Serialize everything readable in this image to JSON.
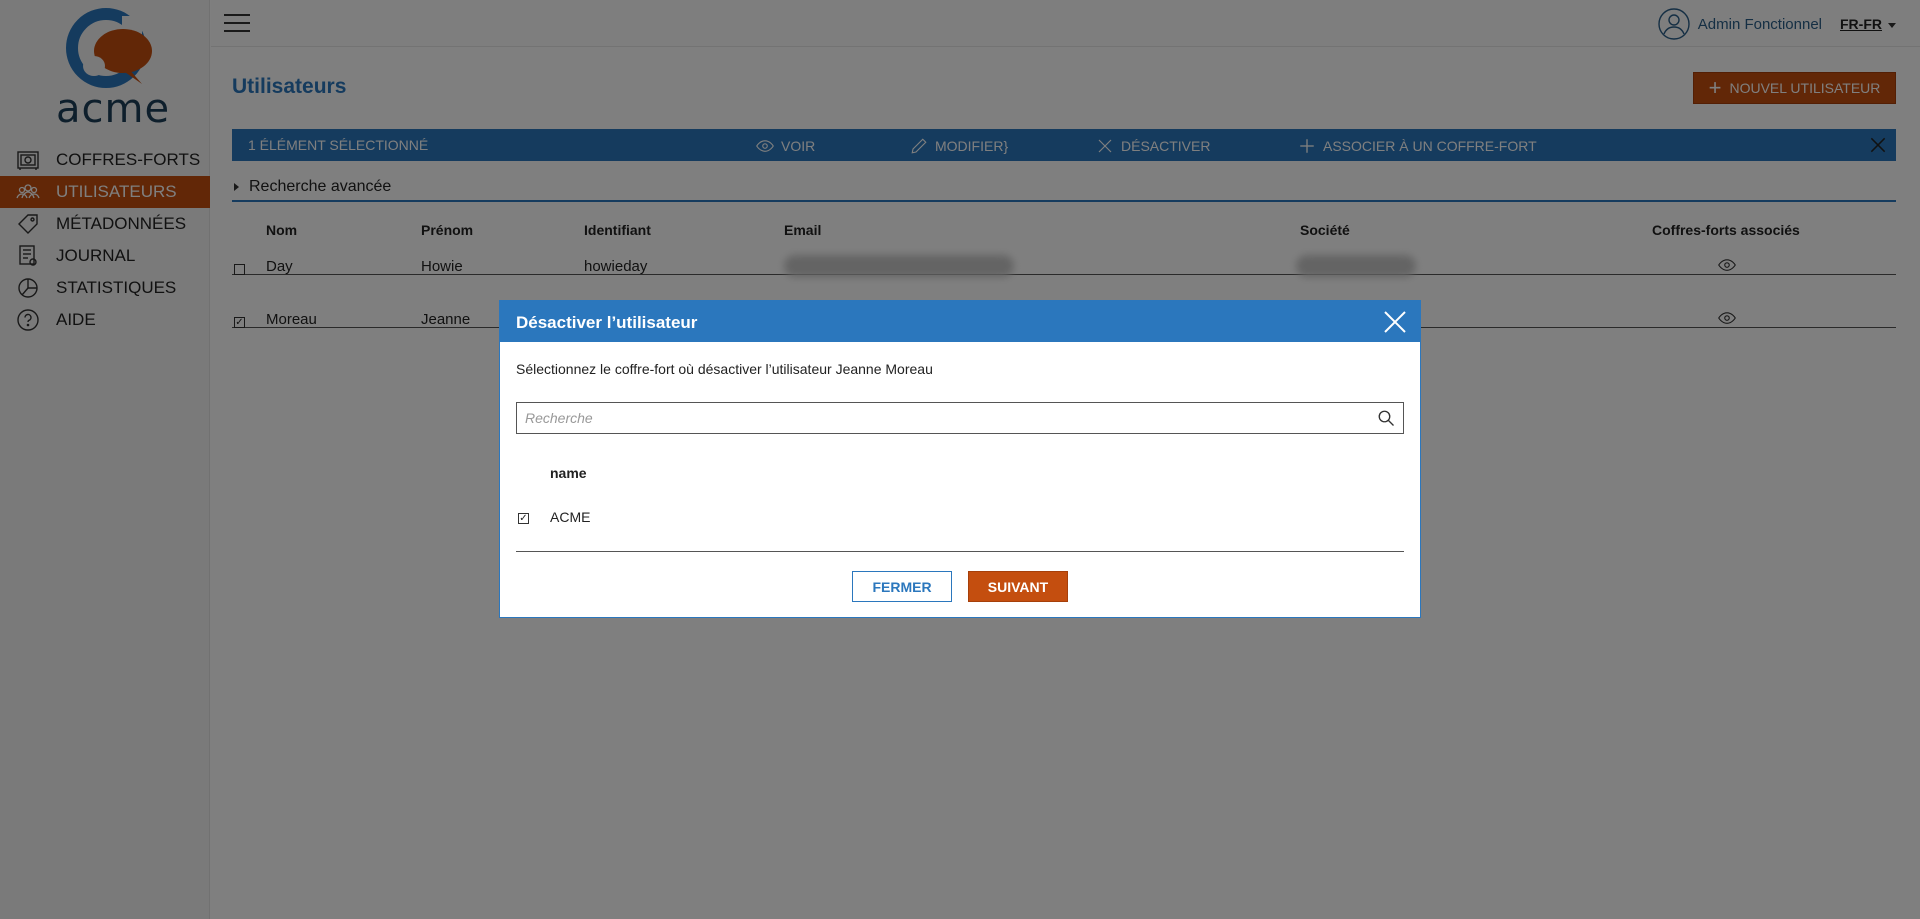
{
  "brand": {
    "name": "acme",
    "primary_color": "#2b77bd",
    "accent_color": "#c44e0f"
  },
  "sidebar": {
    "items": [
      {
        "label": "COFFRES-FORTS",
        "icon": "safe-icon"
      },
      {
        "label": "UTILISATEURS",
        "icon": "users-icon",
        "active": true
      },
      {
        "label": "MÉTADONNÉES",
        "icon": "tag-icon"
      },
      {
        "label": "JOURNAL",
        "icon": "journal-icon"
      },
      {
        "label": "STATISTIQUES",
        "icon": "pie-chart-icon"
      },
      {
        "label": "AIDE",
        "icon": "help-icon"
      }
    ]
  },
  "topbar": {
    "user_name": "Admin Fonctionnel",
    "language": "FR-FR"
  },
  "page": {
    "title": "Utilisateurs",
    "new_user_label": "NOUVEL UTILISATEUR",
    "selection_bar": {
      "count_label": "1 ÉLÉMENT SÉLECTIONNÉ",
      "actions": [
        "VOIR",
        "MODIFIER",
        "DÉSACTIVER",
        "ASSOCIER À UN COFFRE-FORT"
      ]
    },
    "advanced_search_label": "Recherche avancée"
  },
  "table": {
    "columns": [
      "Nom",
      "Prénom",
      "Identifiant",
      "Email",
      "Société",
      "Coffres-forts associés"
    ],
    "rows": [
      {
        "checked": false,
        "nom": "Day",
        "prenom": "Howie",
        "identifiant": "howieday"
      },
      {
        "checked": true,
        "nom": "Moreau",
        "prenom": "Jeanne",
        "identifiant": ""
      }
    ]
  },
  "modal": {
    "title": "Désactiver l’utilisateur",
    "description": "Sélectionnez le coffre-fort où désactiver l’utilisateur Jeanne Moreau",
    "search_placeholder": "Recherche",
    "column_header": "name",
    "vaults": [
      {
        "name": "ACME",
        "checked": true
      }
    ],
    "close_label": "FERMER",
    "next_label": "SUIVANT"
  }
}
